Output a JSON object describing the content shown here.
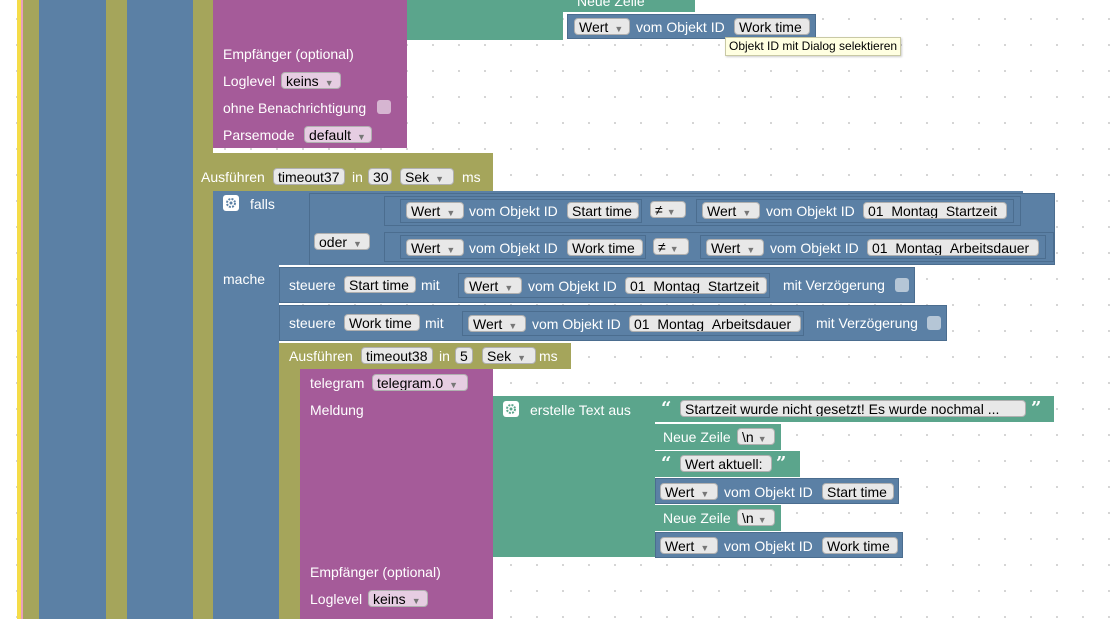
{
  "tooltip": "Objekt ID mit Dialog selektieren",
  "colors": {
    "blue": "#5b80a5",
    "olive": "#a5a55b",
    "purple": "#a55b99",
    "green": "#5ba58c",
    "yellow": "#f5dc48",
    "pink": "#e8a0bc"
  },
  "top": {
    "neue_zeile_label": "Neue Zeile",
    "wert": "Wert",
    "vom_objekt_id": "vom Objekt ID",
    "id_work": "Work time",
    "empfaenger": "Empfänger (optional)",
    "loglevel": "Loglevel",
    "loglevel_value": "keins",
    "ohne_benachrichtigung": "ohne Benachrichtigung",
    "parsemode": "Parsemode",
    "parsemode_value": "default"
  },
  "timeout1": {
    "label": "Ausführen",
    "name": "timeout37",
    "in": "in",
    "value": "30",
    "unit": "Sek",
    "ms": "ms"
  },
  "ifblock": {
    "falls": "falls",
    "mache": "mache",
    "oder": "oder",
    "neq": "≠",
    "c1": {
      "wert": "Wert",
      "vom": "vom Objekt ID",
      "id": "Start time",
      "r_wert": "Wert",
      "r_vom": "vom Objekt ID",
      "r_id": "01_Montag_Startzeit"
    },
    "c2": {
      "wert": "Wert",
      "vom": "vom Objekt ID",
      "id": "Work time",
      "r_wert": "Wert",
      "r_vom": "vom Objekt ID",
      "r_id": "01_Montag_Arbeitsdauer"
    }
  },
  "steuere1": {
    "label": "steuere",
    "id": "Start time",
    "mit": "mit",
    "wert": "Wert",
    "vom": "vom Objekt ID",
    "vid": "01_Montag_Startzeit",
    "delay": "mit Verzögerung"
  },
  "steuere2": {
    "label": "steuere",
    "id": "Work time",
    "mit": "mit",
    "wert": "Wert",
    "vom": "vom Objekt ID",
    "vid": "01_Montag_Arbeitsdauer",
    "delay": "mit Verzögerung"
  },
  "timeout2": {
    "label": "Ausführen",
    "name": "timeout38",
    "in": "in",
    "value": "5",
    "unit": "Sek",
    "ms": "ms"
  },
  "telegram": {
    "label": "telegram",
    "instance": "telegram.0",
    "meldung": "Meldung",
    "erstelle": "erstelle Text aus",
    "text1": "Startzeit wurde nicht gesetzt! Es wurde nochmal ...",
    "neue_zeile": "Neue Zeile",
    "nl": "\\n",
    "text2": "Wert aktuell:",
    "wert": "Wert",
    "vom": "vom Objekt ID",
    "id_start": "Start time",
    "id_work": "Work time",
    "empfaenger": "Empfänger (optional)",
    "loglevel": "Loglevel",
    "loglevel_value": "keins"
  }
}
